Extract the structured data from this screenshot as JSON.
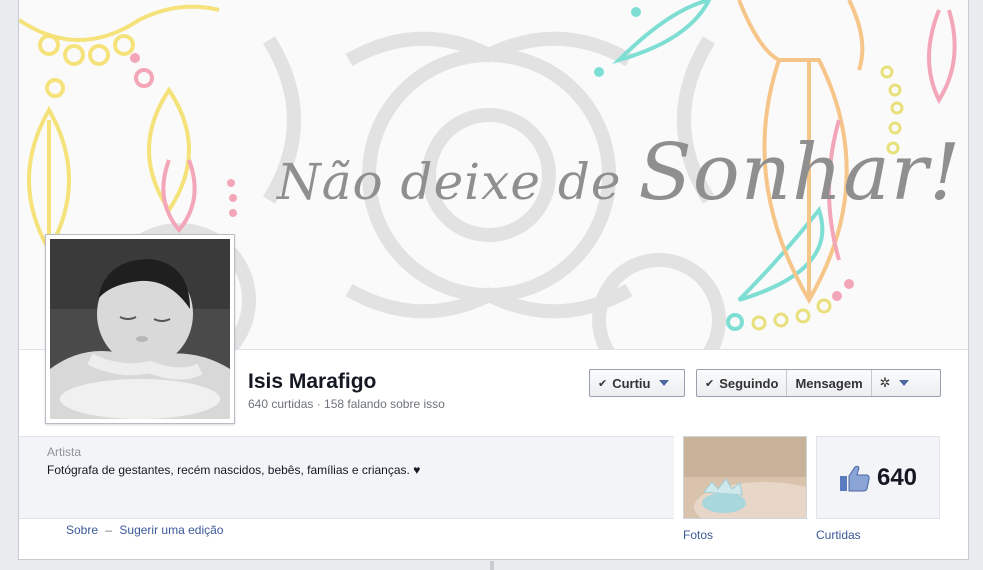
{
  "cover": {
    "text_small": "Não deixe de",
    "text_big": "Sonhar!"
  },
  "page": {
    "name": "Isis Marafigo",
    "stats": "640 curtidas · 158 falando sobre isso"
  },
  "actions": {
    "liked_label": "Curtiu",
    "following_label": "Seguindo",
    "message_label": "Mensagem",
    "settings_icon": "gear-icon"
  },
  "about": {
    "category": "Artista",
    "description": "Fotógrafa de gestantes, recém nascidos, bebês, famílias e crianças. ♥"
  },
  "links": {
    "about": "Sobre",
    "separator": "–",
    "suggest_edit": "Sugerir uma edição"
  },
  "tiles": {
    "photos_label": "Fotos",
    "likes_count": "640",
    "likes_label": "Curtidas"
  },
  "colors": {
    "link": "#3b5998",
    "caret": "#4b67a1"
  }
}
